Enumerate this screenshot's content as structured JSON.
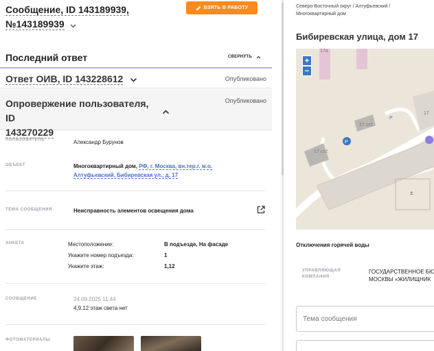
{
  "message": {
    "title_line1": "Сообщение, ID 143189939,",
    "title_line2": "№143189939",
    "take_button": "ВЗЯТЬ В РАБОТУ"
  },
  "last_answer": {
    "label": "Последний ответ",
    "collapse": "СВЕРНУТЬ"
  },
  "answers": {
    "oiv": {
      "name": "Ответ ОИВ, ID 143228612",
      "status": "Опубликовано"
    },
    "refute": {
      "name_line1": "Опровержение пользователя, ID",
      "name_line2": "143270229",
      "status": "Опубликовано"
    }
  },
  "details": {
    "user": {
      "label": "ПОЛЬЗОВАТЕЛЬ",
      "value": "Александр Бурунов"
    },
    "object": {
      "label": "ОБЪЕКТ",
      "type": "Многоквартирный дом,",
      "address_line1": "РФ, г. Москва, вн.тер.г. м.о.",
      "address_line2": "Алтуфьевский, Бибиревская ул., д. 17"
    },
    "topic": {
      "label": "ТЕМА СООБЩЕНИЯ",
      "value": "Неисправность элементов освещения дома"
    },
    "anketa": {
      "label": "АНКЕТА",
      "rows": [
        {
          "key": "Местоположение:",
          "value": "В подъезде, На фасаде"
        },
        {
          "key": "Укажите номер подъезда:",
          "value": "1"
        },
        {
          "key": "Укажите этаж:",
          "value": "1,12"
        }
      ]
    },
    "message": {
      "label": "СООБЩЕНИЕ",
      "date": "24.09.2025 11:44",
      "text": "4,9,12 этаж света нет"
    },
    "photos": {
      "label": "ФОТОМАТЕРИАЛЫ"
    }
  },
  "right": {
    "breadcrumb_line1": "Северо-Восточный округ / Алтуфьевский /",
    "breadcrumb_line2": "Многоквартирный дом",
    "address": "Бибиревская улица, дом 17",
    "map": {
      "labels": {
        "b17a": "17а",
        "b17c1": "17 ст1",
        "b17c2": "17 ст2",
        "b17": "17",
        "parking1": "P",
        "parking2": "P"
      },
      "zoom_in": "+",
      "zoom_out": "−"
    },
    "hot_water_title": "Отключения горячей воды",
    "uk_label_line1": "УПРАВЛЯЮЩАЯ",
    "uk_label_line2": "КОМПАНИЯ",
    "uk_value_line1": "ГОСУДАРСТВЕННОЕ БЮ",
    "uk_value_line2": "МОСКВЫ «ЖИЛИЩНИК",
    "topic_input_placeholder": "Тема сообщения"
  },
  "colors": {
    "accent_orange": "#ff8a1c",
    "link_blue": "#4a6fc4",
    "divider_purple": "#b4b4dc"
  }
}
